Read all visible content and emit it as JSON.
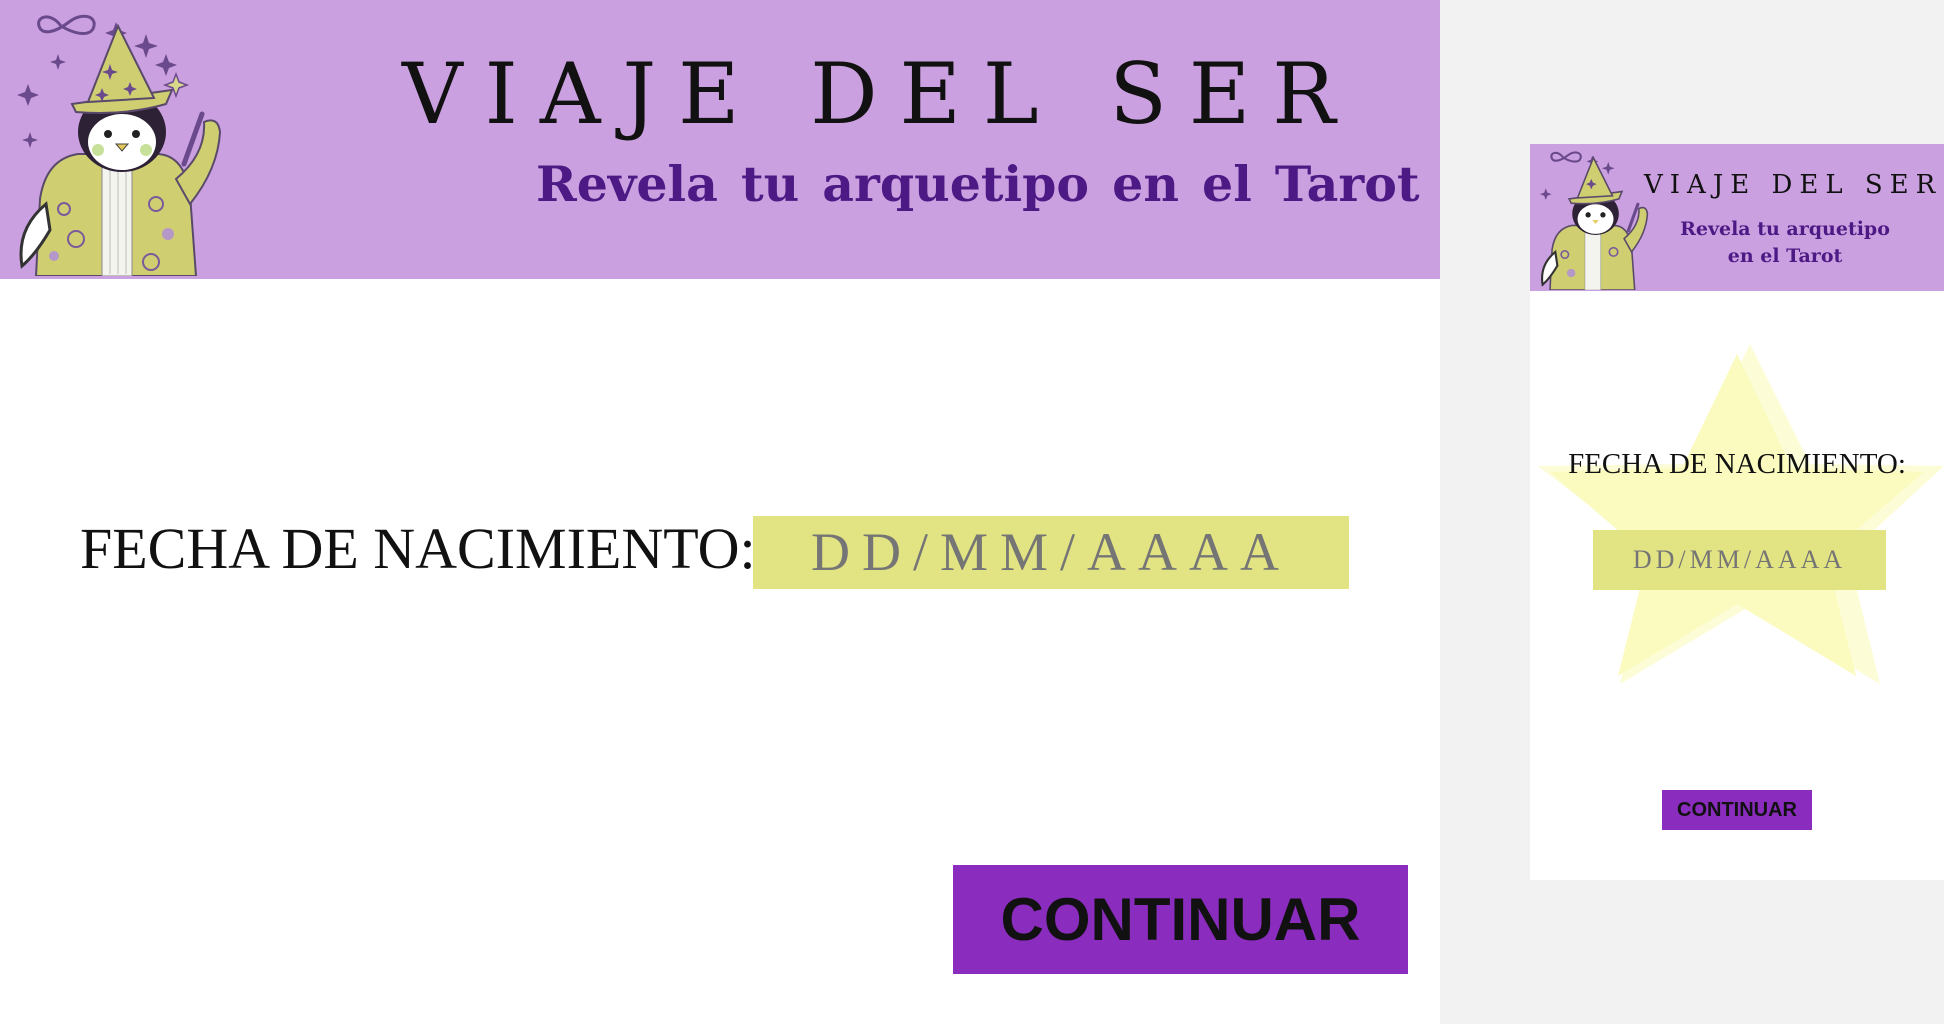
{
  "header": {
    "title": "VIAJE DEL SER",
    "subtitle": "Revela tu arquetipo  en el Tarot"
  },
  "form": {
    "birthdate_label": "FECHA DE NACIMIENTO:",
    "birthdate_placeholder": "DD/MM/AAAA",
    "continue_label": "CONTINUAR"
  },
  "mobile": {
    "title": "VIAJE DEL SER",
    "subtitle_line1": "Revela tu arquetipo",
    "subtitle_line2": "en el Tarot",
    "birthdate_label": "FECHA DE NACIMIENTO:",
    "birthdate_placeholder": "DD/MM/AAAA",
    "continue_label": "CONTINUAR"
  },
  "colors": {
    "banner": "#cba0e0",
    "subtitle_text": "#4d1a85",
    "date_field": "#e2e382",
    "button": "#8a2cbd",
    "star": "#fbfbbf",
    "canvas": "#f2f2f2"
  },
  "icons": [
    "wizard-penguin-mascot",
    "star-icon",
    "infinity-icon"
  ]
}
